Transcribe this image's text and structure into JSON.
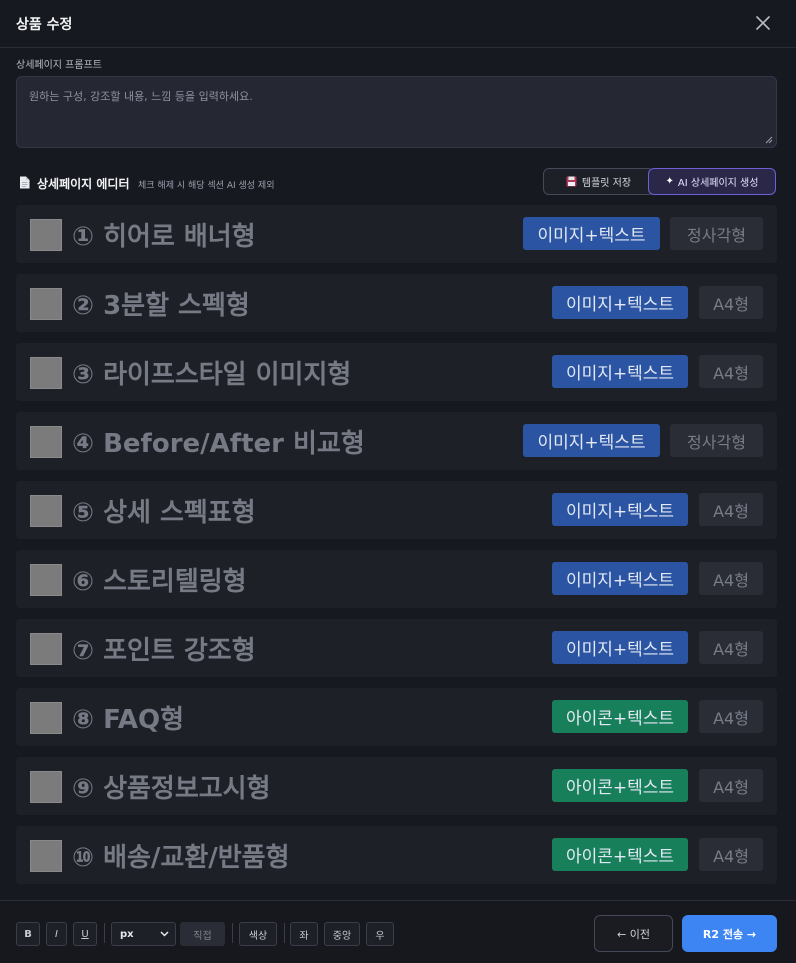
{
  "header": {
    "title": "상품 수정",
    "close_icon": "close-icon"
  },
  "prompt": {
    "label": "상세페이지 프롬프트",
    "placeholder": "원하는 구성, 강조할 내용, 느낌 등을 입력하세요.",
    "value": ""
  },
  "editor": {
    "icon": "document-icon",
    "title": "상세페이지 에디터",
    "hint": "체크 해제 시 해당 섹션 AI 생성 제외",
    "template_button": {
      "icon": "floppy-disk-icon",
      "label": "템플릿 저장"
    },
    "ai_button": {
      "icon": "sparkle-icon",
      "label": "AI 상세페이지 생성"
    }
  },
  "sections": [
    {
      "name": "① 히어로 배너형",
      "type": "이미지+텍스트",
      "type_color": "#2b55a3",
      "ratio": "정사각형",
      "checked": false
    },
    {
      "name": "② 3분할 스펙형",
      "type": "이미지+텍스트",
      "type_color": "#2b55a3",
      "ratio": "A4형",
      "checked": false
    },
    {
      "name": "③ 라이프스타일 이미지형",
      "type": "이미지+텍스트",
      "type_color": "#2b55a3",
      "ratio": "A4형",
      "checked": false
    },
    {
      "name": "④ Before/After 비교형",
      "type": "이미지+텍스트",
      "type_color": "#2b55a3",
      "ratio": "정사각형",
      "checked": false
    },
    {
      "name": "⑤ 상세 스펙표형",
      "type": "이미지+텍스트",
      "type_color": "#2b55a3",
      "ratio": "A4형",
      "checked": false
    },
    {
      "name": "⑥ 스토리텔링형",
      "type": "이미지+텍스트",
      "type_color": "#2b55a3",
      "ratio": "A4형",
      "checked": false
    },
    {
      "name": "⑦ 포인트 강조형",
      "type": "이미지+텍스트",
      "type_color": "#2b55a3",
      "ratio": "A4형",
      "checked": false
    },
    {
      "name": "⑧ FAQ형",
      "type": "아이콘+텍스트",
      "type_color": "#17805a",
      "ratio": "A4형",
      "checked": false
    },
    {
      "name": "⑨ 상품정보고시형",
      "type": "아이콘+텍스트",
      "type_color": "#17805a",
      "ratio": "A4형",
      "checked": false
    },
    {
      "name": "⑩ 배송/교환/반품형",
      "type": "아이콘+텍스트",
      "type_color": "#17805a",
      "ratio": "A4형",
      "checked": false
    }
  ],
  "toolbar": {
    "bold": "B",
    "italic": "I",
    "underline": "U",
    "unit_select": {
      "value": "px",
      "options": [
        "px"
      ],
      "chevron_icon": "chevron-down-icon"
    },
    "direct": "직접",
    "color": "색상",
    "align_left": "좌",
    "align_center": "중앙",
    "align_right": "우"
  },
  "footer": {
    "prev_label": "← 이전",
    "send_label": "R2 전송 →"
  }
}
